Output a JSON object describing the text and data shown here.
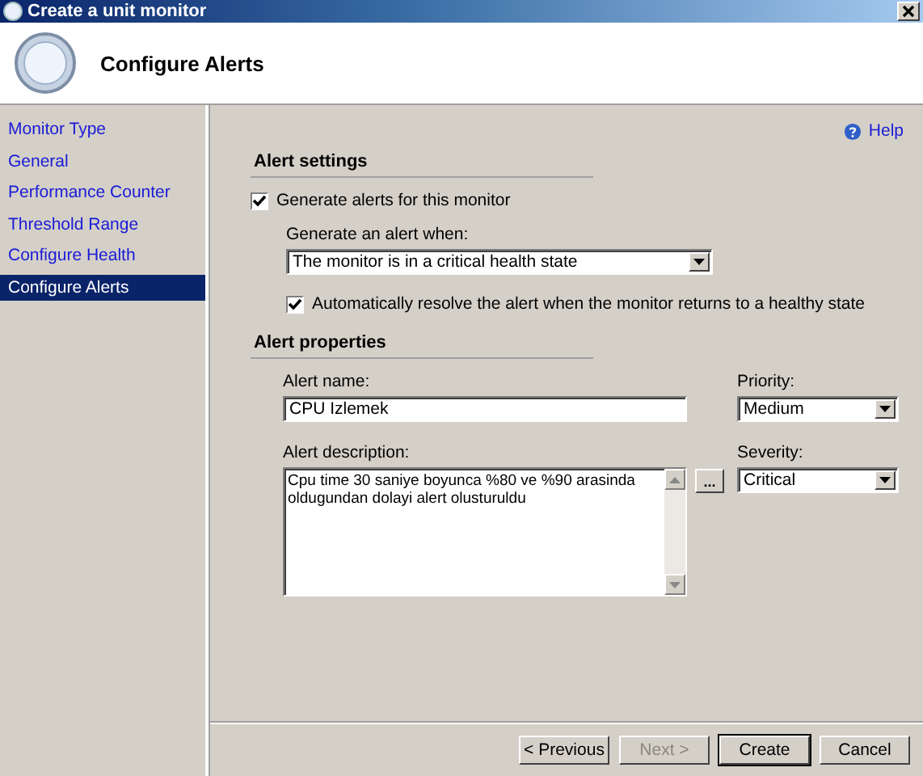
{
  "window": {
    "title": "Create a unit monitor"
  },
  "header": {
    "title": "Configure Alerts"
  },
  "sidebar": {
    "items": [
      {
        "label": "Monitor Type",
        "selected": false
      },
      {
        "label": "General",
        "selected": false
      },
      {
        "label": "Performance Counter",
        "selected": false
      },
      {
        "label": "Threshold Range",
        "selected": false
      },
      {
        "label": "Configure Health",
        "selected": false
      },
      {
        "label": "Configure Alerts",
        "selected": true
      }
    ]
  },
  "help": {
    "label": "Help"
  },
  "alert_settings": {
    "heading": "Alert settings",
    "generate_checkbox": {
      "label": "Generate alerts for this monitor",
      "checked": true
    },
    "when_label": "Generate an alert when:",
    "when_value": "The monitor is in a critical health state",
    "resolve_checkbox": {
      "label": "Automatically resolve the alert when the monitor returns to a healthy state",
      "checked": true
    }
  },
  "alert_properties": {
    "heading": "Alert properties",
    "name_label": "Alert name:",
    "name_value": "CPU Izlemek",
    "priority_label": "Priority:",
    "priority_value": "Medium",
    "description_label": "Alert description:",
    "description_value": "Cpu time 30 saniye boyunca %80 ve %90 arasinda oldugundan dolayi alert olusturuldu",
    "ellipsis_button": "...",
    "severity_label": "Severity:",
    "severity_value": "Critical"
  },
  "buttons": [
    {
      "label": "< Previous",
      "disabled": false,
      "default": false
    },
    {
      "label": "Next >",
      "disabled": true,
      "default": false
    },
    {
      "label": "Create",
      "disabled": false,
      "default": true
    },
    {
      "label": "Cancel",
      "disabled": false,
      "default": false
    }
  ]
}
